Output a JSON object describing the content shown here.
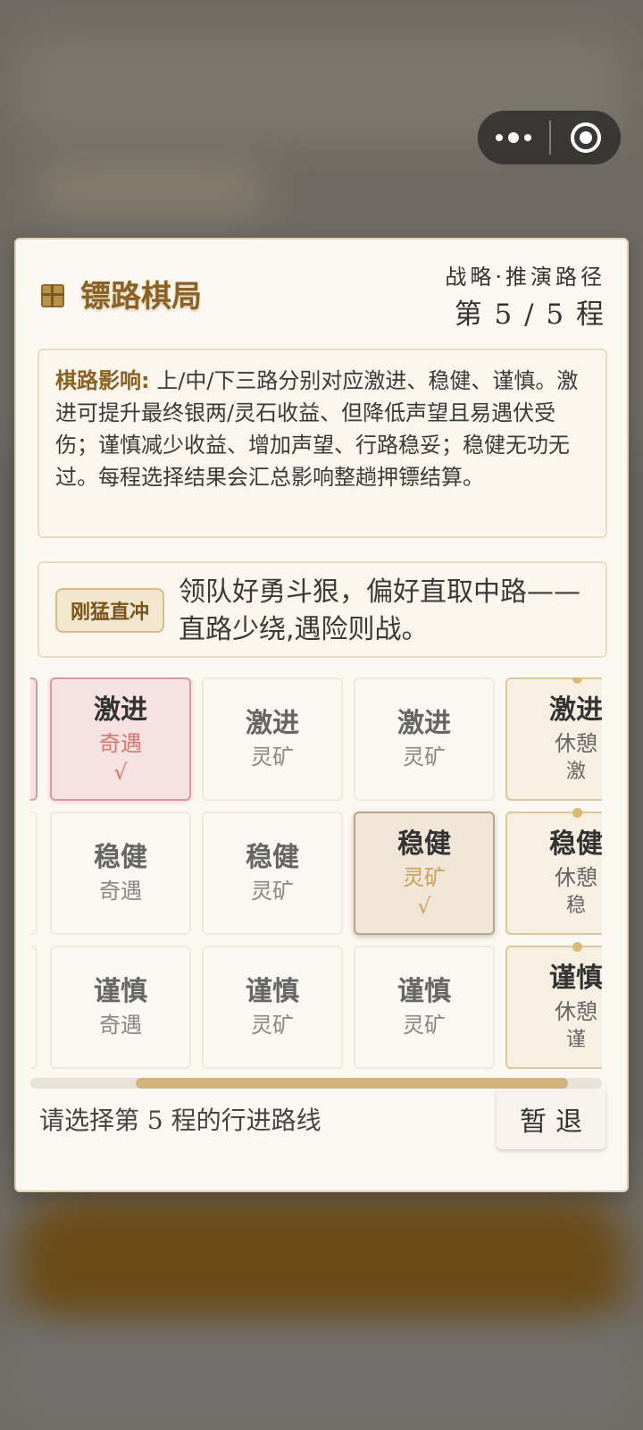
{
  "capsule": {
    "more_icon": "more-dots-icon",
    "close_icon": "target-circle-icon"
  },
  "dialog": {
    "title": "镖路棋局",
    "title_icon": "box-icon",
    "subtitle": "战略·推演路径",
    "stage": "第 5 / 5 程",
    "info": {
      "label": "棋路影响:",
      "text": " 上/中/下三路分别对应激进、稳健、谨慎。激进可提升最终银两/灵石收益、但降低声望且易遇伏受伤；谨慎减少收益、增加声望、行路稳妥；稳健无功无过。每程选择结果会汇总影响整趟押镖结算。"
    },
    "leader": {
      "tag": "刚猛直冲",
      "text": "领队好勇斗狠，偏好直取中路——直路少绕,遇险则战。"
    },
    "grid": {
      "rows": [
        {
          "cells": [
            {
              "main": "激进",
              "sub": "奇遇",
              "mark": "√"
            },
            {
              "main": "激进",
              "sub": "灵矿"
            },
            {
              "main": "激进",
              "sub": "灵矿"
            },
            {
              "main": "激进",
              "sub": "休憩",
              "extra": "激"
            }
          ]
        },
        {
          "cells": [
            {
              "main": "稳健",
              "sub": "奇遇"
            },
            {
              "main": "稳健",
              "sub": "灵矿"
            },
            {
              "main": "稳健",
              "sub": "灵矿",
              "mark": "√"
            },
            {
              "main": "稳健",
              "sub": "休憩",
              "extra": "稳"
            }
          ]
        },
        {
          "cells": [
            {
              "main": "谨慎",
              "sub": "奇遇"
            },
            {
              "main": "谨慎",
              "sub": "灵矿"
            },
            {
              "main": "谨慎",
              "sub": "灵矿"
            },
            {
              "main": "谨慎",
              "sub": "休憩",
              "extra": "谨"
            }
          ]
        }
      ],
      "scroll_fraction": 0.76
    },
    "footer_prompt": "请选择第 5 程的行进路线",
    "retreat_label": "暂退"
  },
  "colors": {
    "accent_gold": "#8a6223",
    "picked_red": "#d9756c",
    "picked_gold": "#c9a258"
  }
}
